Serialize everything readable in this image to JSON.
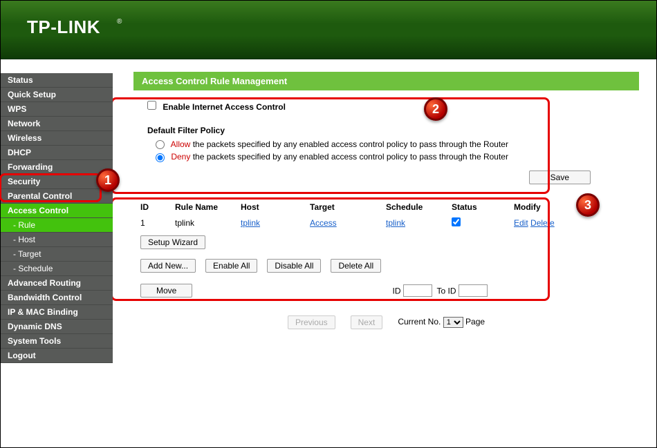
{
  "brand": "TP-LINK",
  "brand_reg": "®",
  "sidebar": {
    "items": [
      {
        "label": "Status"
      },
      {
        "label": "Quick Setup"
      },
      {
        "label": "WPS"
      },
      {
        "label": "Network"
      },
      {
        "label": "Wireless"
      },
      {
        "label": "DHCP"
      },
      {
        "label": "Forwarding"
      },
      {
        "label": "Security"
      },
      {
        "label": "Parental Control"
      },
      {
        "label": "Access Control",
        "active": true,
        "subs": [
          {
            "label": "- Rule",
            "active": true
          },
          {
            "label": "- Host"
          },
          {
            "label": "- Target"
          },
          {
            "label": "- Schedule"
          }
        ]
      },
      {
        "label": "Advanced Routing"
      },
      {
        "label": "Bandwidth Control"
      },
      {
        "label": "IP & MAC Binding"
      },
      {
        "label": "Dynamic DNS"
      },
      {
        "label": "System Tools"
      },
      {
        "label": "Logout"
      }
    ]
  },
  "page": {
    "title": "Access Control Rule Management"
  },
  "control": {
    "enable_label": "Enable Internet Access Control",
    "enable_checked": false,
    "policy_heading": "Default Filter Policy",
    "allow_option": "Allow",
    "allow_text": " the packets specified by any enabled access control policy to pass through the Router",
    "deny_option": "Deny",
    "deny_text": " the packets specified by any enabled access control policy to pass through the Router",
    "selected_policy": "deny",
    "save_label": "Save"
  },
  "table": {
    "cols": [
      "ID",
      "Rule Name",
      "Host",
      "Target",
      "Schedule",
      "Status",
      "Modify"
    ],
    "rows": [
      {
        "id": "1",
        "rule_name": "tplink",
        "host": "tplink",
        "target": "Access",
        "schedule": "tplink",
        "status_checked": true,
        "edit": "Edit",
        "delete": "Delete"
      }
    ]
  },
  "buttons": {
    "setup_wizard": "Setup Wizard",
    "add_new": "Add New...",
    "enable_all": "Enable All",
    "disable_all": "Disable All",
    "delete_all": "Delete All",
    "move": "Move",
    "id_label": "ID",
    "to_id_label": "To ID",
    "previous": "Previous",
    "next": "Next",
    "current_no": "Current No.",
    "page_suffix": "Page",
    "page_value": "1"
  },
  "annotations": {
    "b1": "1",
    "b2": "2",
    "b3": "3"
  }
}
